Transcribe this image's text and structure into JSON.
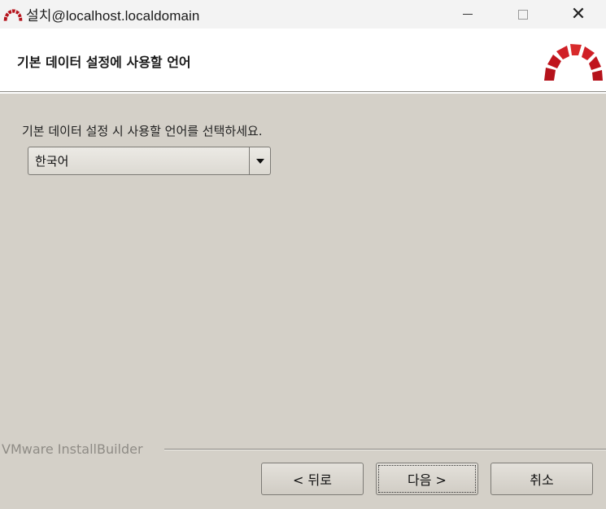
{
  "titlebar": {
    "title": "설치@localhost.localdomain",
    "app_icon": "redmine-arc-icon",
    "minimize_icon": "minimize-icon",
    "maximize_icon": "maximize-icon",
    "close_icon": "close-icon",
    "close_glyph": "✕"
  },
  "header": {
    "heading": "기본 데이터 설정에 사용할 언어",
    "logo": "redmine-logo"
  },
  "body": {
    "instruction": "기본 데이터 설정 시 사용할 언어를 선택하세요.",
    "language_select": {
      "selected": "한국어"
    }
  },
  "footer": {
    "brand": "VMware InstallBuilder",
    "buttons": {
      "back": "< 뒤로",
      "next": "다음 >",
      "cancel": "취소"
    }
  },
  "colors": {
    "window_bg": "#d4d0c8",
    "header_bg": "#ffffff",
    "logo_red": "#b5121b",
    "titlebar_bg": "#f3f3f3"
  }
}
